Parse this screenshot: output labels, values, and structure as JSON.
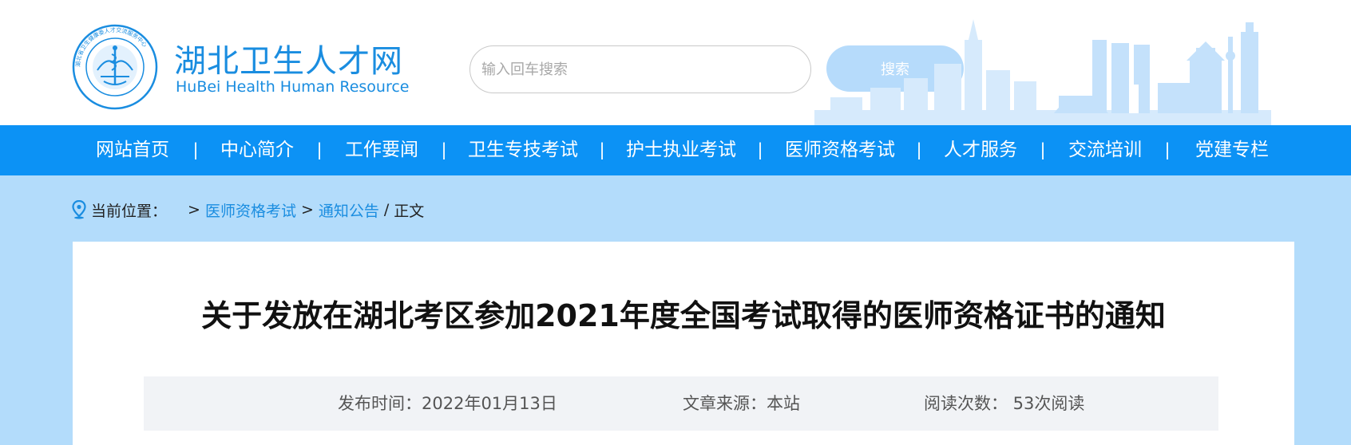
{
  "header": {
    "logo": {
      "ring_text": "湖北省卫生健康委人才交流服务中心",
      "ring_text_en": "Hubei Provincial Health Commission Talent Exchange"
    },
    "site_title": "湖北卫生人才网",
    "site_subtitle": "HuBei Health Human Resource",
    "search": {
      "placeholder": "输入回车搜索",
      "value": "",
      "button_label": "搜索"
    }
  },
  "nav": {
    "items": [
      {
        "label": "网站首页"
      },
      {
        "label": "中心简介"
      },
      {
        "label": "工作要闻"
      },
      {
        "label": "卫生专技考试"
      },
      {
        "label": "护士执业考试"
      },
      {
        "label": "医师资格考试"
      },
      {
        "label": "人才服务"
      },
      {
        "label": "交流培训"
      },
      {
        "label": "党建专栏"
      }
    ],
    "separator": "|"
  },
  "breadcrumb": {
    "label": "当前位置：",
    "separator": ">",
    "links": [
      "医师资格考试",
      "通知公告"
    ],
    "slash": "/",
    "current": "正文"
  },
  "article": {
    "title": "关于发放在湖北考区参加2021年度全国考试取得的医师资格证书的通知",
    "meta": {
      "publish_time": "发布时间：2022年01月13日",
      "source": "文章来源：本站",
      "read_count": "阅读次数：  53次阅读"
    }
  },
  "colors": {
    "brand_blue": "#1a8de0",
    "nav_bg": "#0c92f5",
    "page_bg": "#b3dcfb",
    "search_button_bg": "#b6dbfb",
    "meta_bg": "#f1f3f6"
  },
  "icons": [
    "hubei-health-logo-icon",
    "city-skyline-icon",
    "location-pin-icon"
  ]
}
